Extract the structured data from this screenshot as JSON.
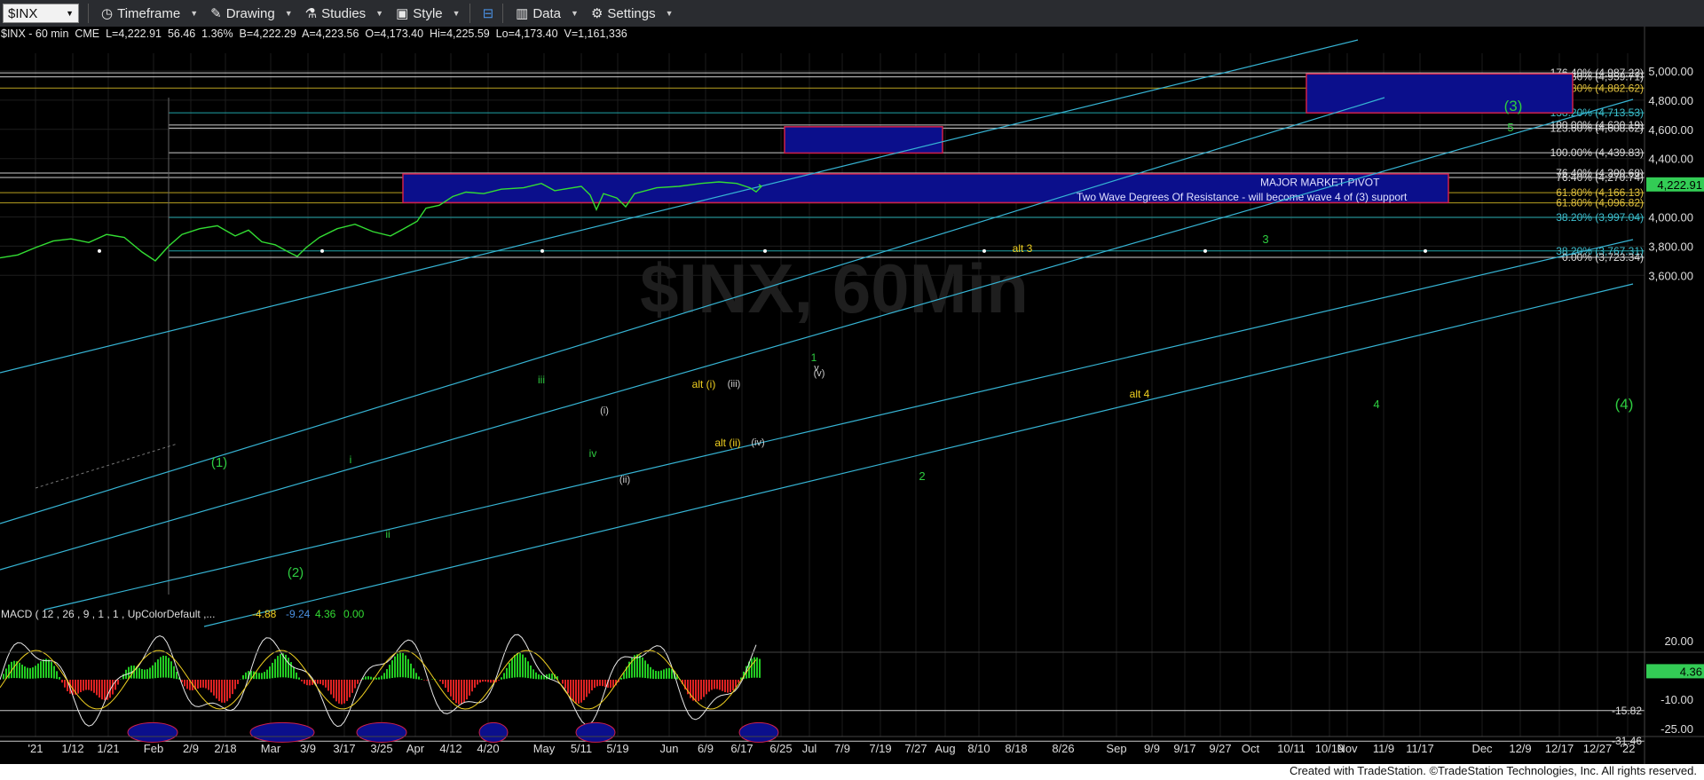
{
  "toolbar": {
    "symbol": "$INX",
    "items": [
      "Timeframe",
      "Drawing",
      "Studies",
      "Style",
      "Data",
      "Settings"
    ]
  },
  "info": {
    "line": "$INX - 60 min  CME  L=4,222.91  56.46  1.36%  B=4,222.29  A=4,223.56  O=4,173.40  Hi=4,225.59  Lo=4,173.40  V=1,161,336"
  },
  "watermark": "$INX, 60Min",
  "price_axis": {
    "ticks": [
      "5,000.00",
      "4,800.00",
      "4,600.00",
      "4,400.00",
      "4,000.00",
      "3,800.00",
      "3,600.00"
    ],
    "last_price": "4,222.91"
  },
  "fib_labels": [
    "176.40% (4,987.23)",
    "123.60% (4,959.71)",
    "161.80% (4,882.62)",
    "138.20% (4,713.53)",
    "100.00% (4,630.19)",
    "123.60% (4,608.62)",
    "100.00% (4,439.83)",
    "76.40% (4,300.68)",
    "76.40% (4,270.74)",
    "61.80% (4,166.13)",
    "61.80% (4,096.82)",
    "38.20% (3,997.04)",
    "38.20% (3,767.31)",
    "0.00% (3,723.34)"
  ],
  "wave_labels": {
    "green": [
      "(3)",
      "5",
      "3",
      "4",
      "(4)",
      "1",
      "(1)",
      "(2)",
      "2",
      "iii",
      "iv",
      "ii",
      "i"
    ],
    "yellow": [
      "alt 3",
      "alt 4",
      "alt (i)",
      "alt (ii)"
    ],
    "white": [
      "(iii)",
      "(i)",
      "(iv)",
      "(ii)",
      "v",
      "(v)"
    ]
  },
  "zone_texts": {
    "pivot": "MAJOR MARKET PIVOT",
    "resistance": "Two Wave Degrees Of Resistance - will become wave 4 of (3) support"
  },
  "macd": {
    "label": "MACD ( 12 , 26 , 9 , 1 , 1 , UpColorDefault ,...",
    "values": [
      "-4.88",
      "-9.24",
      "4.36",
      "0.00"
    ],
    "axis": [
      "20.00",
      "-10.00",
      "-25.00"
    ],
    "markers": [
      "4.36",
      "-15.82",
      "-31.46"
    ]
  },
  "time_axis": [
    "'21",
    "1/12",
    "1/21",
    "Feb",
    "2/9",
    "2/18",
    "Mar",
    "3/9",
    "3/17",
    "3/25",
    "Apr",
    "4/12",
    "4/20",
    "May",
    "5/11",
    "5/19",
    "Jun",
    "6/9",
    "6/17",
    "6/25",
    "Jul",
    "7/9",
    "7/19",
    "7/27",
    "Aug",
    "8/10",
    "8/18",
    "8/26",
    "Sep",
    "9/9",
    "9/17",
    "9/27",
    "Oct",
    "10/11",
    "10/19",
    "Nov",
    "11/9",
    "11/17",
    "Dec",
    "12/9",
    "12/17",
    "12/27",
    "'22"
  ],
  "footer": "Created with TradeStation. ©TradeStation Technologies, Inc. All rights reserved.",
  "colors": {
    "blue_zone": "#0b0f8c",
    "zone_border": "#d0204a",
    "channel": "#36b4d4",
    "wave_green": "#2ecc40",
    "wave_yellow": "#f0d020",
    "price_line": "#33dd33"
  }
}
